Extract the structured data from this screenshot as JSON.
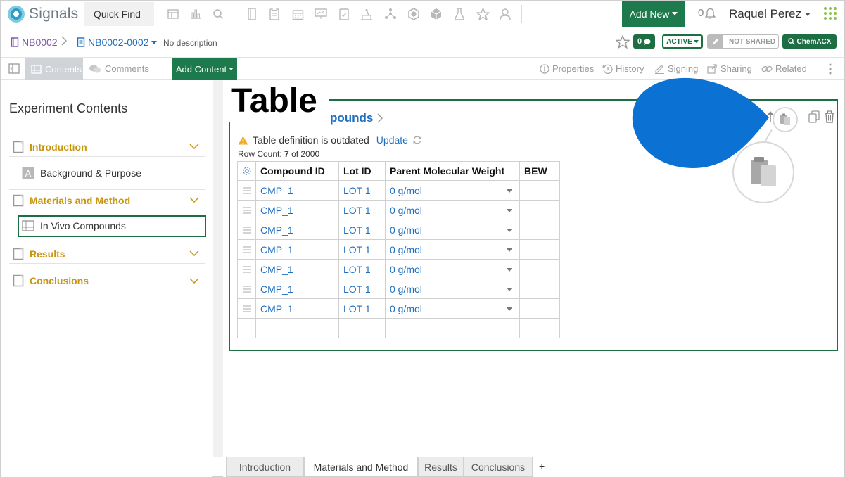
{
  "app": {
    "name": "Signals",
    "quick_find": "Quick Find"
  },
  "header": {
    "add_new": "Add New",
    "notification_count": "0",
    "user_name": "Raquel Perez"
  },
  "breadcrumb": {
    "notebook": "NB0002",
    "experiment": "NB0002-0002",
    "description": "No description"
  },
  "badges": {
    "comments": "0",
    "status": "ACTIVE",
    "sharing": "NOT SHARED",
    "chemacx": "ChemACX"
  },
  "toolbar": {
    "contents": "Contents",
    "comments": "Comments",
    "add_content": "Add Content",
    "properties": "Properties",
    "history": "History",
    "signing": "Signing",
    "sharing": "Sharing",
    "related": "Related"
  },
  "sidebar": {
    "title": "Experiment Contents",
    "sections": [
      {
        "label": "Introduction"
      },
      {
        "label": "Materials and Method"
      },
      {
        "label": "Results"
      },
      {
        "label": "Conclusions"
      }
    ],
    "items": [
      {
        "label": "Background & Purpose"
      },
      {
        "label": "In Vivo Compounds"
      }
    ]
  },
  "card": {
    "overlay_label": "Table",
    "title": "pounds",
    "warning": "Table definition is outdated",
    "update": "Update",
    "row_count_label": "Row Count:",
    "row_count": "7",
    "row_count_max": "of 2000",
    "columns": [
      "Compound ID",
      "Lot ID",
      "Parent Molecular Weight",
      "BEW"
    ],
    "rows": [
      {
        "compound_id": "CMP_1",
        "lot_id": "LOT 1",
        "mw": "0 g/mol",
        "bew": ""
      },
      {
        "compound_id": "CMP_1",
        "lot_id": "LOT 1",
        "mw": "0 g/mol",
        "bew": ""
      },
      {
        "compound_id": "CMP_1",
        "lot_id": "LOT 1",
        "mw": "0 g/mol",
        "bew": ""
      },
      {
        "compound_id": "CMP_1",
        "lot_id": "LOT 1",
        "mw": "0 g/mol",
        "bew": ""
      },
      {
        "compound_id": "CMP_1",
        "lot_id": "LOT 1",
        "mw": "0 g/mol",
        "bew": ""
      },
      {
        "compound_id": "CMP_1",
        "lot_id": "LOT 1",
        "mw": "0 g/mol",
        "bew": ""
      },
      {
        "compound_id": "CMP_1",
        "lot_id": "LOT 1",
        "mw": "0 g/mol",
        "bew": ""
      }
    ]
  },
  "bottom_tabs": [
    {
      "label": "Introduction"
    },
    {
      "label": "Materials and Method"
    },
    {
      "label": "Results"
    },
    {
      "label": "Conclusions"
    }
  ],
  "bottom_add": "+",
  "colors": {
    "brand_green": "#1d7a4c",
    "link_blue": "#1f6fc0",
    "section_gold": "#c79510",
    "callout_blue": "#0b72d4"
  }
}
